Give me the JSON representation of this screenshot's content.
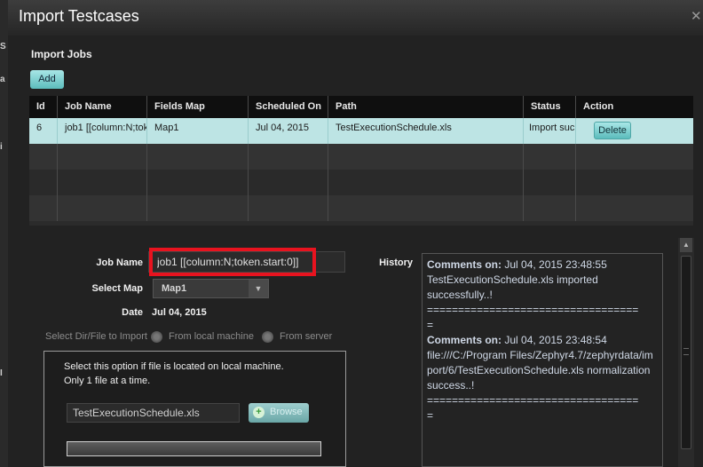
{
  "left_strip": {
    "glyphs": [
      "S",
      "a",
      "i",
      "I"
    ]
  },
  "dialog": {
    "title": "Import Testcases",
    "close_icon": "close-icon"
  },
  "import_jobs": {
    "title": "Import Jobs",
    "add_label": "Add",
    "columns": [
      "Id",
      "Job Name",
      "Fields Map",
      "Scheduled On",
      "Path",
      "Status",
      "Action"
    ],
    "rows": [
      {
        "id": "6",
        "job_name": "job1 [[column:N;toke",
        "fields_map": "Map1",
        "scheduled_on": "Jul 04, 2015",
        "path": "TestExecutionSchedule.xls",
        "status": "Import suc",
        "action": "Delete"
      }
    ]
  },
  "form": {
    "job_name_label": "Job Name",
    "job_name_value": "job1 [[column:N;token.start:0]]",
    "select_map_label": "Select Map",
    "select_map_value": "Map1",
    "date_label": "Date",
    "date_value": "Jul 04, 2015",
    "select_dir_label": "Select Dir/File to Import",
    "option_local": "From local machine",
    "option_server": "From server",
    "local_hint_line1": "Select this option if file is located on local machine.",
    "local_hint_line2": "Only 1 file at a time.",
    "file_value": "TestExecutionSchedule.xls",
    "browse_label": "Browse"
  },
  "history": {
    "label": "History",
    "entries": [
      {
        "prefix": "Comments on:",
        "timestamp": "Jul 04, 2015 23:48:55",
        "text": "TestExecutionSchedule.xls imported successfully..!"
      },
      {
        "prefix": "Comments on:",
        "timestamp": "Jul 04, 2015 23:48:54",
        "text": "file:///C:/Program Files/Zephyr4.7/zephyrdata/import/6/TestExecutionSchedule.xls normalization success..!"
      }
    ],
    "separator": "=================================="
  },
  "colors": {
    "selected_row": "#bde4e4",
    "teal_button": "#5cbcbc",
    "highlight_box": "#e8131f"
  }
}
